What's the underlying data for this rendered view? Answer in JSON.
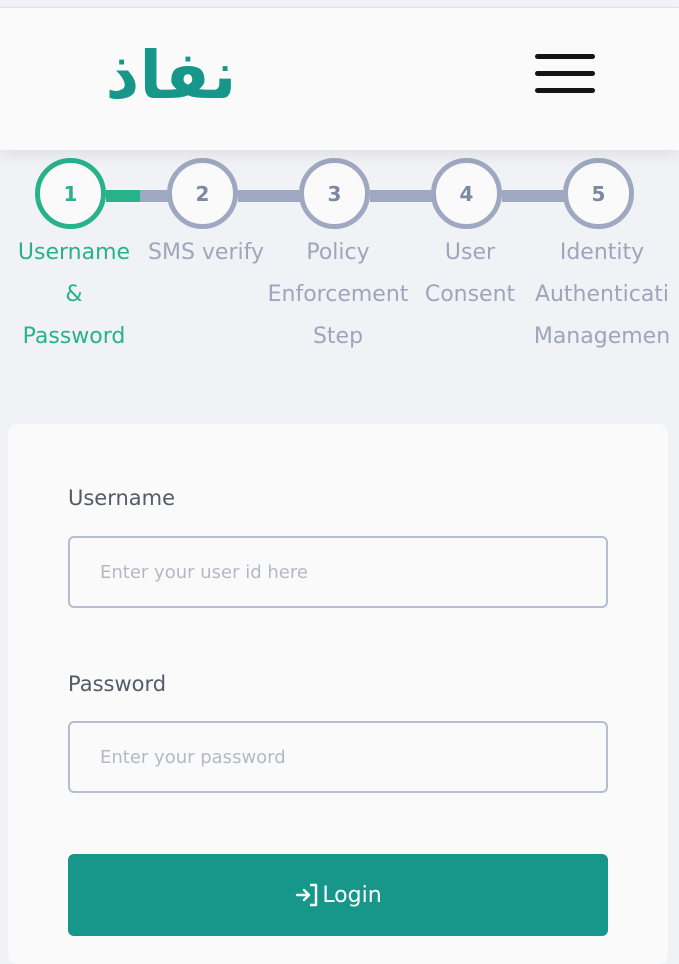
{
  "header": {
    "logo_text": "نفاذ",
    "menu_icon": "hamburger-menu-icon"
  },
  "colors": {
    "brand": "#16978a",
    "active_step": "#27b28c",
    "inactive_step": "#9ea8c0"
  },
  "stepper": {
    "active_step": 1,
    "steps": [
      {
        "number": "1",
        "label_lines": [
          "Username",
          "&",
          "Password"
        ]
      },
      {
        "number": "2",
        "label_lines": [
          "SMS verify"
        ]
      },
      {
        "number": "3",
        "label_lines": [
          "Policy",
          "Enforcement",
          "Step"
        ]
      },
      {
        "number": "4",
        "label_lines": [
          "User",
          "Consent"
        ]
      },
      {
        "number": "5",
        "label_lines": [
          "Identity",
          "Authenticati",
          "Managemen"
        ]
      }
    ]
  },
  "form": {
    "username": {
      "label": "Username",
      "placeholder": "Enter your user id here",
      "value": ""
    },
    "password": {
      "label": "Password",
      "placeholder": "Enter your password",
      "value": ""
    },
    "login_button": {
      "label": "Login",
      "icon": "login-arrow-icon"
    }
  }
}
